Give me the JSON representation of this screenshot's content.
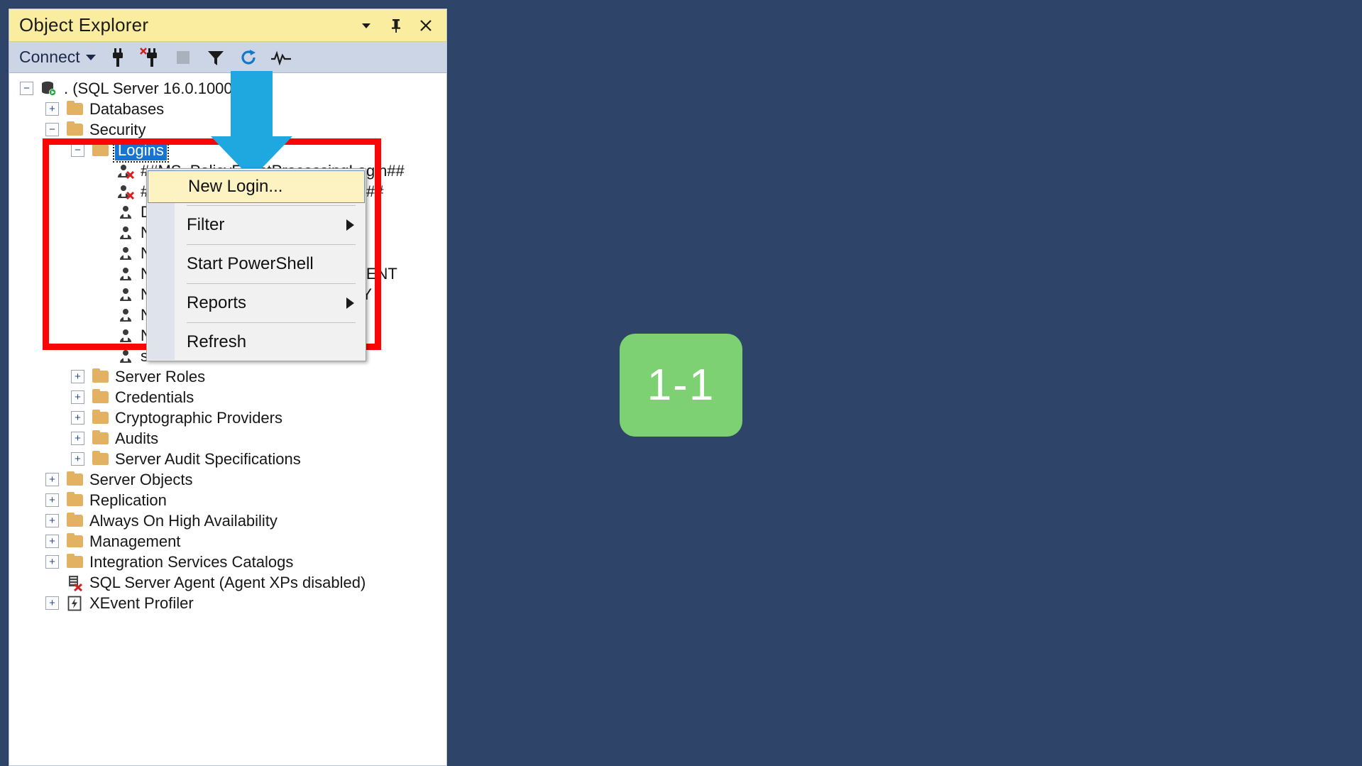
{
  "panel": {
    "title": "Object Explorer",
    "title_buttons": [
      {
        "name": "window-dropdown-icon",
        "glyph": "▾"
      },
      {
        "name": "pin-icon",
        "glyph": "⚲"
      },
      {
        "name": "close-icon",
        "glyph": "✕"
      }
    ],
    "toolbar": {
      "connect_label": "Connect",
      "icons": [
        "connect-plug-icon",
        "disconnect-plug-icon",
        "stop-icon",
        "filter-icon",
        "refresh-icon",
        "activity-monitor-icon"
      ]
    }
  },
  "tree": [
    {
      "label": ". (SQL Server 16.0.1000 - sa)",
      "indent": 0,
      "expander": "minus",
      "icon": "server-icon"
    },
    {
      "label": "Databases",
      "indent": 1,
      "expander": "plus",
      "icon": "folder-icon"
    },
    {
      "label": "Security",
      "indent": 1,
      "expander": "minus",
      "icon": "folder-icon"
    },
    {
      "label": "Logins",
      "indent": 2,
      "expander": "minus",
      "icon": "folder-icon",
      "selected": true
    },
    {
      "label": "##MS_PolicyEventProcessingLogin##",
      "indent": 3,
      "expander": "none",
      "icon": "login-disabled-icon"
    },
    {
      "label": "##MS_PolicyTsqlExecutionLogin##",
      "indent": 3,
      "expander": "none",
      "icon": "login-disabled-icon"
    },
    {
      "label": "DESKTOP-XXXXX₩user",
      "indent": 3,
      "expander": "none",
      "icon": "login-icon"
    },
    {
      "label": "NT AUTHORITY₩SYSTEM",
      "indent": 3,
      "expander": "none",
      "icon": "login-icon"
    },
    {
      "label": "NT SERVICE₩MSSQLSERVER",
      "indent": 3,
      "expander": "none",
      "icon": "login-icon"
    },
    {
      "label": "NT SERVICE₩SQLSERVERAGENT",
      "indent": 3,
      "expander": "none",
      "icon": "login-icon"
    },
    {
      "label": "NT SERVICE₩SQLTELEMETRY",
      "indent": 3,
      "expander": "none",
      "icon": "login-icon"
    },
    {
      "label": "NT SERVICE₩SQLWriter",
      "indent": 3,
      "expander": "none",
      "icon": "login-icon"
    },
    {
      "label": "NT SERVICE₩Winmgmt",
      "indent": 3,
      "expander": "none",
      "icon": "login-icon"
    },
    {
      "label": "sa",
      "indent": 3,
      "expander": "none",
      "icon": "login-icon"
    },
    {
      "label": "Server Roles",
      "indent": 2,
      "expander": "plus",
      "icon": "folder-icon"
    },
    {
      "label": "Credentials",
      "indent": 2,
      "expander": "plus",
      "icon": "folder-icon"
    },
    {
      "label": "Cryptographic Providers",
      "indent": 2,
      "expander": "plus",
      "icon": "folder-icon"
    },
    {
      "label": "Audits",
      "indent": 2,
      "expander": "plus",
      "icon": "folder-icon"
    },
    {
      "label": "Server Audit Specifications",
      "indent": 2,
      "expander": "plus",
      "icon": "folder-icon"
    },
    {
      "label": "Server Objects",
      "indent": 1,
      "expander": "plus",
      "icon": "folder-icon"
    },
    {
      "label": "Replication",
      "indent": 1,
      "expander": "plus",
      "icon": "folder-icon"
    },
    {
      "label": "Always On High Availability",
      "indent": 1,
      "expander": "plus",
      "icon": "folder-icon"
    },
    {
      "label": "Management",
      "indent": 1,
      "expander": "plus",
      "icon": "folder-icon"
    },
    {
      "label": "Integration Services Catalogs",
      "indent": 1,
      "expander": "plus",
      "icon": "folder-icon"
    },
    {
      "label": "SQL Server Agent (Agent XPs disabled)",
      "indent": 1,
      "expander": "none",
      "icon": "agent-disabled-icon"
    },
    {
      "label": "XEvent Profiler",
      "indent": 1,
      "expander": "plus",
      "icon": "xevent-icon"
    }
  ],
  "context_menu": {
    "items": [
      {
        "label": "New Login...",
        "highlighted": true,
        "submenu": false
      },
      {
        "label": "Filter",
        "highlighted": false,
        "submenu": true
      },
      {
        "label": "Start PowerShell",
        "highlighted": false,
        "submenu": false
      },
      {
        "label": "Reports",
        "highlighted": false,
        "submenu": true
      },
      {
        "label": "Refresh",
        "highlighted": false,
        "submenu": false
      }
    ]
  },
  "annotations": {
    "step_badge": "1-1",
    "highlight_color": "#f90606",
    "arrow_color": "#1fa8e0",
    "badge_color": "#7ed172"
  }
}
